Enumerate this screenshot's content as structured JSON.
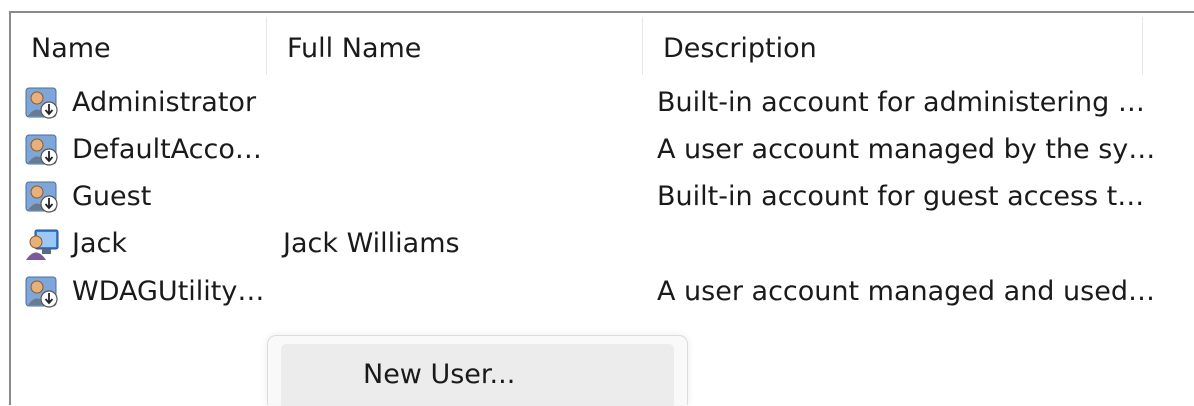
{
  "columns": {
    "name": "Name",
    "full_name": "Full Name",
    "description": "Description"
  },
  "users": [
    {
      "name": "Administrator",
      "full_name": "",
      "description": "Built-in account for administering …",
      "icon": "managed-user-icon"
    },
    {
      "name": "DefaultAcco…",
      "full_name": "",
      "description": "A user account managed by the sy…",
      "icon": "managed-user-icon"
    },
    {
      "name": "Guest",
      "full_name": "",
      "description": "Built-in account for guest access t…",
      "icon": "managed-user-icon"
    },
    {
      "name": "Jack",
      "full_name": "Jack Williams",
      "description": "",
      "icon": "user-icon"
    },
    {
      "name": "WDAGUtility…",
      "full_name": "",
      "description": "A user account managed and used…",
      "icon": "managed-user-icon"
    }
  ],
  "context_menu": {
    "items": [
      {
        "label": "New User..."
      }
    ]
  }
}
